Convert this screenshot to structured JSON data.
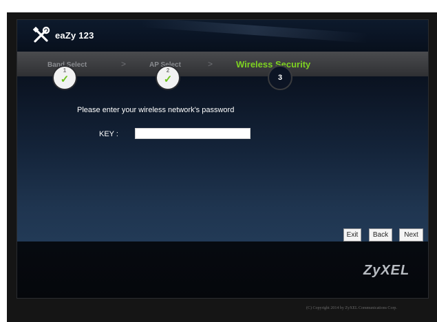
{
  "header": {
    "title": "eaZy 123",
    "icon": "tools-icon"
  },
  "steps": [
    {
      "label": "Band Select",
      "number": "1",
      "status": "done"
    },
    {
      "label": "AP Select",
      "number": "2",
      "status": "done"
    },
    {
      "label": "Wireless Security",
      "number": "3",
      "status": "current"
    }
  ],
  "form": {
    "prompt": "Please enter your wireless network's password",
    "key_label": "KEY :",
    "key_value": "",
    "key_placeholder": ""
  },
  "buttons": {
    "exit": "Exit",
    "back": "Back",
    "next": "Next"
  },
  "brand": "ZyXEL",
  "copyright": "(C) Copyright 2014 by ZyXEL Communications Corp.",
  "colors": {
    "active_step": "#7ed321",
    "check": "#6cc21a"
  }
}
